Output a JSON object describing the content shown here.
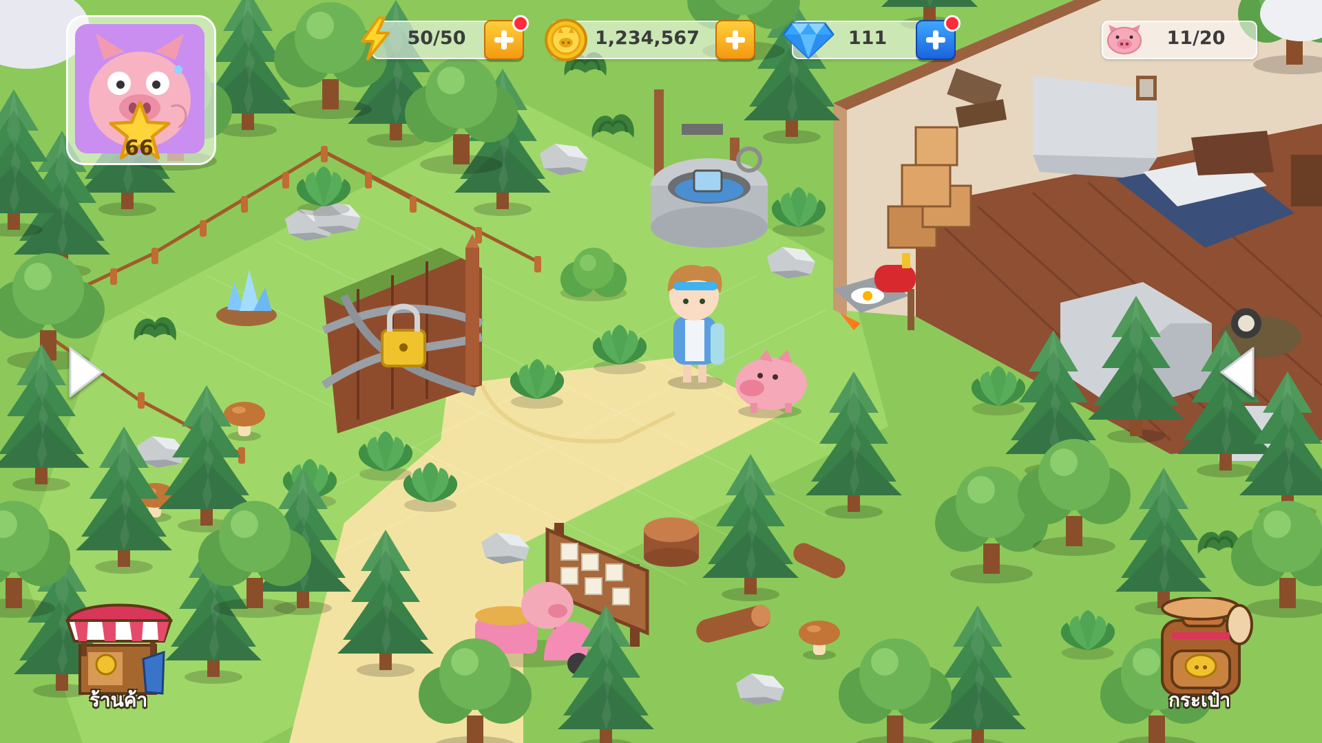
{
  "hud": {
    "player_level": "66",
    "energy": "50/50",
    "coins": "1,234,567",
    "gems": "111",
    "pigs": "11/20"
  },
  "buttons": {
    "shop_label": "ร้านค้า",
    "bag_label": "กระเป๋า"
  },
  "colors": {
    "plus_orange": "#f7a81b",
    "plus_blue": "#1f74e8",
    "notification": "#ff2a3a",
    "grass": "#8cc95a",
    "path": "#f3e3a2"
  },
  "icons": {
    "energy": "lightning-icon",
    "coin": "pig-coin-icon",
    "gem": "diamond-icon",
    "pig_count": "pig-face-icon"
  }
}
